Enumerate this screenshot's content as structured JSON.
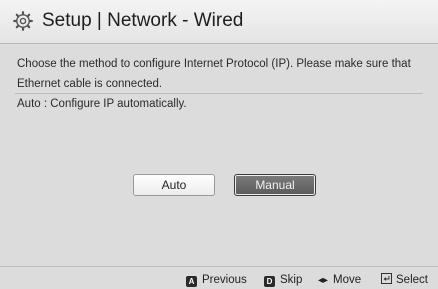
{
  "header": {
    "title": "Setup | Network - Wired",
    "icon": "gear-icon"
  },
  "content": {
    "description": "Choose the method to configure Internet Protocol (IP). Please make sure that Ethernet cable is connected.",
    "hint": "Auto : Configure IP automatically."
  },
  "buttons": {
    "auto_label": "Auto",
    "manual_label": "Manual"
  },
  "footer": {
    "previous": {
      "key": "A",
      "label": "Previous"
    },
    "skip": {
      "key": "D",
      "label": "Skip"
    },
    "move": {
      "icon": "left-right-arrows-icon",
      "label": "Move"
    },
    "select": {
      "icon": "return-icon",
      "label": "Select"
    }
  },
  "colors": {
    "background": "#dcdcdc",
    "selected_button": "#6a6a6a",
    "key_badge": "#2a2a2a"
  }
}
